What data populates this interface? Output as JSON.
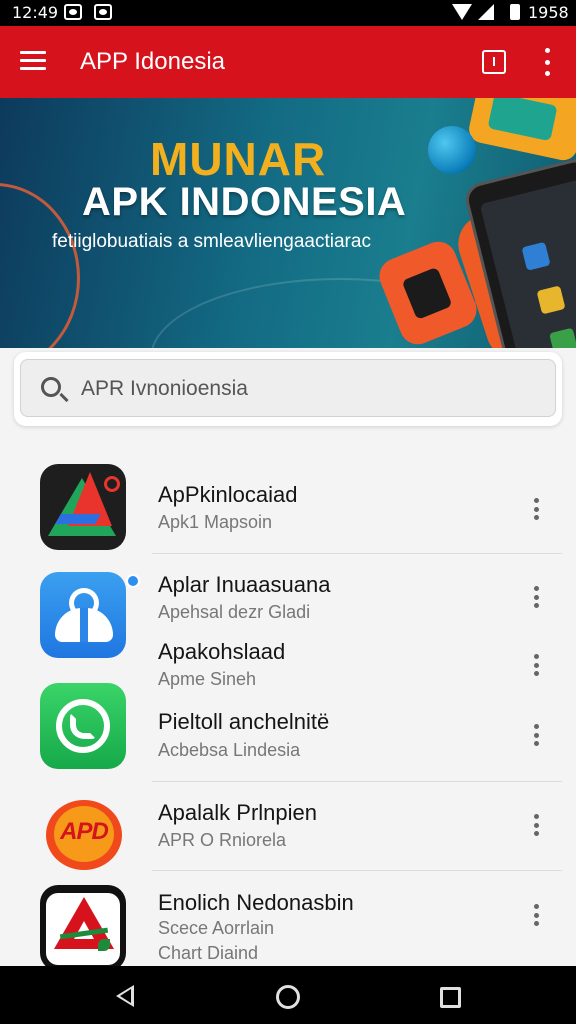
{
  "status_bar": {
    "time": "12:49",
    "battery_text": "1958"
  },
  "app_bar": {
    "title": "APP Idonesia"
  },
  "banner": {
    "headline": "MUNAR",
    "title": "APK INDONESIA",
    "subtitle": "fetiiglobuatiais a smleavliengaactiarac"
  },
  "search": {
    "value": "APR Ivnonioensia"
  },
  "apps": [
    {
      "title": "ApPkinlocaiad",
      "subtitle": "Apk1 Mapsoin"
    },
    {
      "title": "Aplar Inuaasuana",
      "subtitle": "Apehsal dezr Gladi"
    },
    {
      "title": "Apakohslaad",
      "subtitle": "Apme Sineh"
    },
    {
      "title": "Pieltoll anchelnitë",
      "subtitle": "Acbebsa Lindesia"
    },
    {
      "title": "Apalalk Prlnpien",
      "subtitle": "APR O Rniorela"
    },
    {
      "title": "Enolich Nedonasbin",
      "subtitle": "Scece Aorrlain",
      "subtitle2": "Chart Diaind"
    }
  ],
  "icons": {
    "app1": "apk-a-logo-icon",
    "app2": "shopping-bag-icon",
    "app3": "phone-call-icon",
    "app4": "apd-badge-icon",
    "app5": "red-a-logo-icon"
  },
  "colors": {
    "app_bar": "#d6121c",
    "banner_accent": "#f2b01e",
    "badge": "#2f8ff0"
  }
}
